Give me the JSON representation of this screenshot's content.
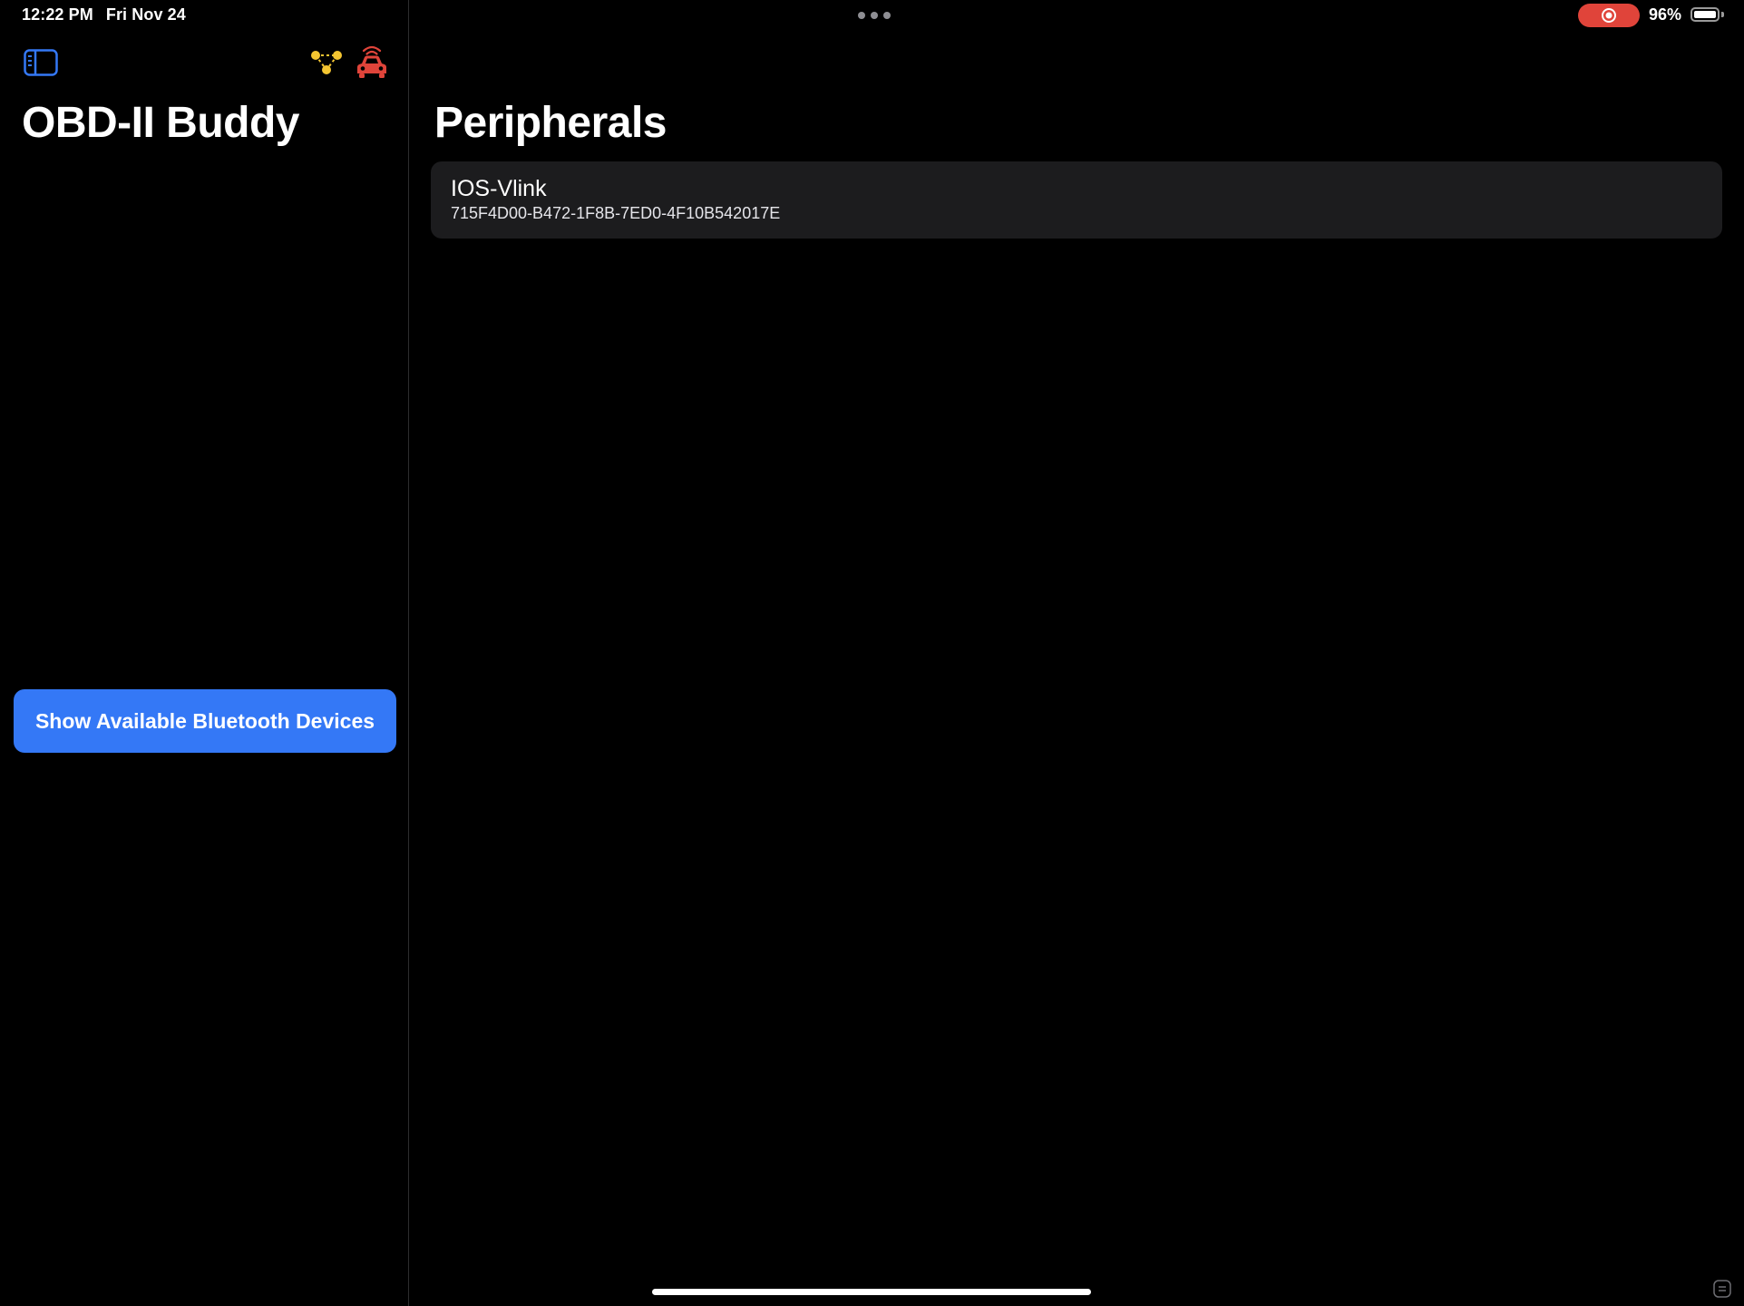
{
  "status_bar": {
    "time": "12:22 PM",
    "date": "Fri Nov 24",
    "battery_percent": "96%",
    "battery_level": 0.96,
    "recording_color": "#e0443a"
  },
  "sidebar": {
    "title": "OBD-II Buddy",
    "toggle_icon": "sidebar-toggle-icon",
    "network_icon": "network-nodes-icon",
    "car_icon": "car-signal-icon",
    "bluetooth_button_label": "Show Available Bluetooth Devices",
    "accent_color": "#3478f6"
  },
  "main": {
    "title": "Peripherals",
    "peripherals": [
      {
        "name": "IOS-Vlink",
        "uuid": "715F4D00-B472-1F8B-7ED0-4F10B542017E"
      }
    ]
  }
}
